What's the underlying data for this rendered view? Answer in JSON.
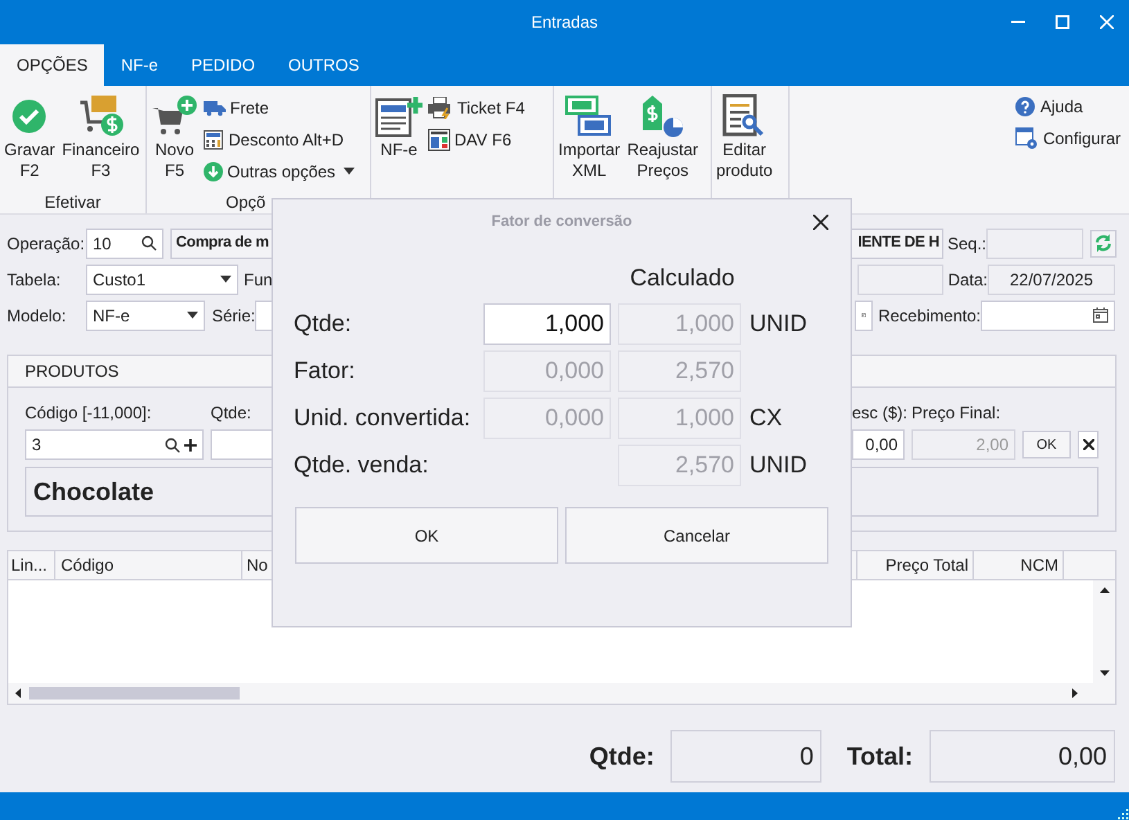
{
  "window": {
    "title": "Entradas"
  },
  "ribbon_tabs": [
    {
      "label": "OPÇÕES",
      "selected": true
    },
    {
      "label": "NF-e",
      "selected": false
    },
    {
      "label": "PEDIDO",
      "selected": false
    },
    {
      "label": "OUTROS",
      "selected": false
    }
  ],
  "ribbon_groups": [
    {
      "label": "Efetivar",
      "large": [
        {
          "lines": [
            "Gravar",
            "F2"
          ],
          "kind": "check"
        },
        {
          "lines": [
            "Financeiro",
            "F3"
          ],
          "kind": "cart_money"
        }
      ]
    },
    {
      "label": "Opçõ",
      "large": [
        {
          "lines": [
            "Novo",
            "F5"
          ],
          "kind": "cart_plus"
        }
      ],
      "small": [
        {
          "label": "Frete",
          "kind": "truck"
        },
        {
          "label": "Desconto Alt+D",
          "kind": "calc"
        },
        {
          "label": "Outras opções",
          "kind": "down",
          "dropdown": true
        }
      ]
    },
    {
      "large": [
        {
          "lines": [
            "NF-e"
          ],
          "kind": "doc_plus"
        }
      ],
      "small": [
        {
          "label": "Ticket F4",
          "kind": "printer"
        },
        {
          "label": "DAV F6",
          "kind": "dav"
        }
      ]
    },
    {
      "large": [
        {
          "lines": [
            "Importar",
            "XML"
          ],
          "kind": "xml"
        },
        {
          "lines": [
            "Reajustar",
            "Preços"
          ],
          "kind": "price"
        }
      ]
    },
    {
      "large": [
        {
          "lines": [
            "Editar",
            "produto"
          ],
          "kind": "edit_doc"
        }
      ]
    }
  ],
  "ribbon_right": [
    {
      "label": "Ajuda",
      "kind": "help"
    },
    {
      "label": "Configurar",
      "kind": "config"
    }
  ],
  "header_form": {
    "operation_label": "Operação:",
    "operation_code": "10",
    "operation_name": "Compra de m",
    "table_label": "Tabela:",
    "table_value": "Custo1",
    "func_label": "Fun",
    "model_label": "Modelo:",
    "model_value": "NF-e",
    "series_label": "Série:",
    "supplier": "IENTE DE H",
    "seq_label": "Seq.:",
    "date_label": "Data:",
    "date": "22/07/2025",
    "receipt_label": "Recebimento:"
  },
  "products": {
    "title": "PRODUTOS",
    "code_label": "Código [-11,000]:",
    "code": "3",
    "qty_label": "Qtde:",
    "discount_label": "esc ($):",
    "discount": "0,00",
    "final_label": "Preço Final:",
    "final_price": "2,00",
    "ok": "OK",
    "product_name": "Chocolate"
  },
  "grid": {
    "columns": [
      "Lin...",
      "Código",
      "No",
      "Preço Total",
      "NCM"
    ]
  },
  "totals": {
    "qty_label": "Qtde:",
    "qty": "0",
    "total_label": "Total:",
    "total": "0,00"
  },
  "dialog": {
    "title": "Fator de conversão",
    "column_header": "Calculado",
    "rows": [
      {
        "label": "Qtde:",
        "input": {
          "value": "1,000",
          "disabled": false
        },
        "calculated": "1,000",
        "unit": "UNID"
      },
      {
        "label": "Fator:",
        "input": {
          "value": "0,000",
          "disabled": true
        },
        "calculated": "2,570"
      },
      {
        "label": "Unid. convertida:",
        "input": {
          "value": "0,000",
          "disabled": true
        },
        "calculated": "1,000",
        "unit": "CX"
      },
      {
        "label": "Qtde. venda:",
        "calculated": "2,570",
        "unit": "UNID"
      }
    ],
    "buttons": [
      "OK",
      "Cancelar"
    ]
  }
}
